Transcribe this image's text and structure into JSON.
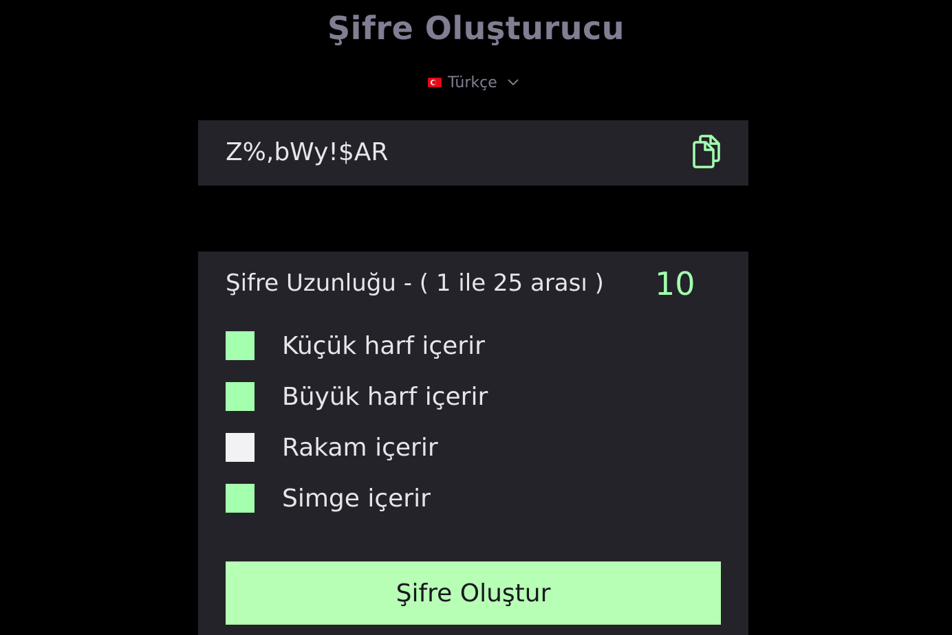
{
  "header": {
    "title": "Şifre Oluşturucu"
  },
  "language": {
    "flag_icon": "turkey-flag-icon",
    "selected": "Türkçe",
    "dropdown_icon": "chevron-down-icon"
  },
  "output": {
    "password": "Z%,bWy!$AR",
    "copy_icon": "copy-icon"
  },
  "settings": {
    "length_label": "Şifre Uzunluğu - ( 1 ile 25 arası )",
    "length_value": "10",
    "options": [
      {
        "label": "Küçük harf içerir",
        "checked": true
      },
      {
        "label": "Büyük harf içerir",
        "checked": true
      },
      {
        "label": "Rakam içerir",
        "checked": false
      },
      {
        "label": "Simge içerir",
        "checked": true
      }
    ]
  },
  "actions": {
    "generate_label": "Şifre Oluştur"
  },
  "colors": {
    "background": "#000000",
    "panel": "#24232a",
    "accent": "#a4ffaf",
    "button": "#b7ffb4",
    "title": "#817d92",
    "text": "#e6e5ea",
    "unchecked": "#f2f2f2"
  }
}
